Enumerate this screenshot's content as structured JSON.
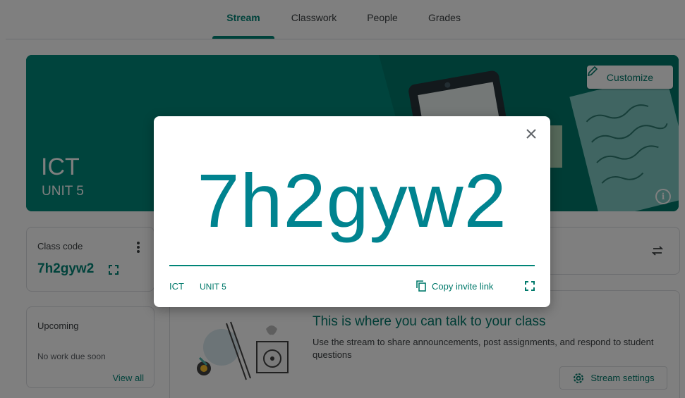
{
  "nav": {
    "tabs": [
      {
        "label": "Stream",
        "active": true
      },
      {
        "label": "Classwork"
      },
      {
        "label": "People"
      },
      {
        "label": "Grades"
      }
    ]
  },
  "banner": {
    "title": "ICT",
    "section": "UNIT 5",
    "customize_label": "Customize",
    "info_icon": "info-icon"
  },
  "class_code_card": {
    "label": "Class code",
    "code": "7h2gyw2"
  },
  "upcoming_card": {
    "title": "Upcoming",
    "text": "No work due soon",
    "view_all": "View all"
  },
  "stream": {
    "title": "This is where you can talk to your class",
    "description": "Use the stream to share announcements, post assignments, and respond to student questions",
    "settings_label": "Stream settings"
  },
  "dialog": {
    "code": "7h2gyw2",
    "class_name": "ICT",
    "section": "UNIT 5",
    "copy_label": "Copy invite link"
  },
  "colors": {
    "accent": "#008577",
    "banner": "#00897b",
    "code_text": "#00838f"
  }
}
